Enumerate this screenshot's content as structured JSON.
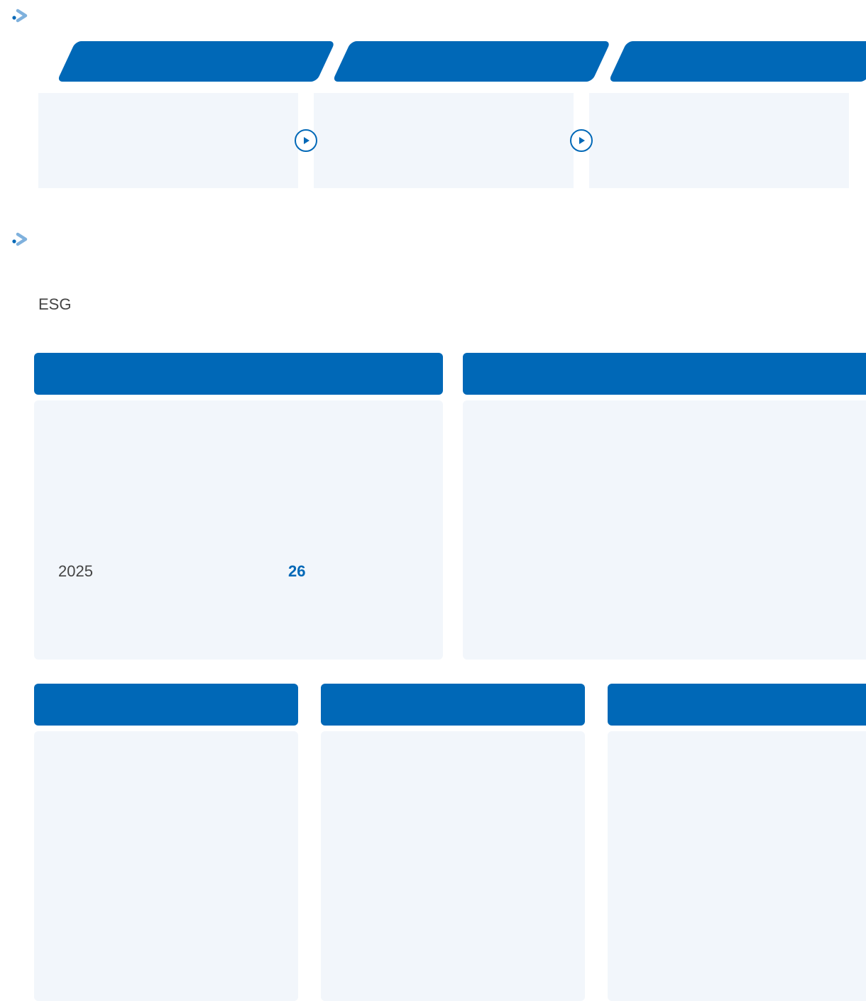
{
  "colors": {
    "brand": "#0068b7",
    "panel": "#f2f6fb",
    "marker_light": "#7fb1dd"
  },
  "icons": {
    "section_marker": "chevron-right-icon",
    "step_arrow": "play-circle-icon"
  },
  "esg_section": {
    "label": "ESG",
    "featured_card": {
      "year": "2025",
      "count": "26"
    }
  }
}
